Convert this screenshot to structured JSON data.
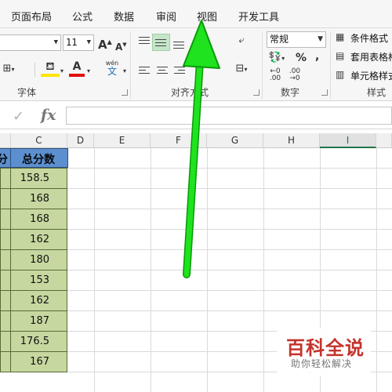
{
  "menu": {
    "tabs": [
      "页面布局",
      "公式",
      "数据",
      "审阅",
      "视图",
      "开发工具"
    ]
  },
  "ribbon": {
    "font": {
      "label": "字体",
      "size": "11",
      "grow": "A",
      "shrink": "A",
      "phonetic_top": "wén",
      "phonetic_bottom": "文"
    },
    "alignment": {
      "label": "对齐方式"
    },
    "number": {
      "label": "数字",
      "format": "常规",
      "percent": "%",
      "comma": ",",
      "inc_decimal": "←0\n.00",
      "dec_decimal": ".00\n→0"
    },
    "styles": {
      "label": "样式",
      "items": [
        "条件格式",
        "套用表格格式",
        "单元格样式"
      ]
    }
  },
  "formula_bar": {
    "enter_symbol": "✓",
    "fx": "fx",
    "value": ""
  },
  "columns": [
    "C",
    "D",
    "E",
    "F",
    "G",
    "H",
    "I"
  ],
  "selected_column": "I",
  "sheet": {
    "partial_header": "分",
    "header": "总分数",
    "values": [
      "158.5",
      "168",
      "168",
      "162",
      "180",
      "153",
      "162",
      "187",
      "176.5",
      "167"
    ]
  },
  "watermark": {
    "title": "百科全说",
    "subtitle": "助你轻松解决"
  },
  "colors": {
    "header_fill": "#5b8fd0",
    "data_fill": "#c6d8a0",
    "arrow": "#1ee31e",
    "accent": "#217346",
    "brand": "#c4332c"
  }
}
